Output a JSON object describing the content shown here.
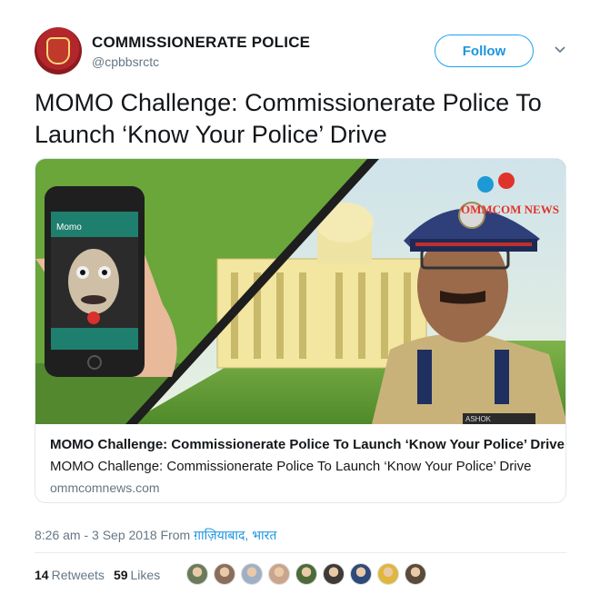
{
  "account": {
    "name": "COMMISSIONERATE POLICE",
    "handle": "@cpbbsrctc",
    "avatar_icon": "police-emblem"
  },
  "follow_label": "Follow",
  "tweet_text": "MOMO Challenge: Commissionerate Police To Launch ‘Know Your Police’ Drive",
  "card": {
    "title": "MOMO Challenge: Commissionerate Police To Launch ‘Know Your Police’ Drive",
    "description": "MOMO Challenge: Commissionerate Police To Launch ‘Know Your Police’ Drive",
    "domain": "ommcomnews.com",
    "image": {
      "watermark": "OMMCOM NEWS",
      "phone_contact_name": "Momo",
      "badge_text": "ASHOK"
    }
  },
  "timestamp": {
    "time": "8:26 am - 3 Sep 2018",
    "from_label": "From",
    "location": "ग़ाज़ियाबाद, भारत"
  },
  "stats": {
    "retweets_count": "14",
    "retweets_label": "Retweets",
    "likes_count": "59",
    "likes_label": "Likes"
  },
  "likers": [
    {
      "color": "#6b7b5a"
    },
    {
      "color": "#8a6d5b"
    },
    {
      "color": "#9fb0c4"
    },
    {
      "color": "#c9a58b"
    },
    {
      "color": "#4d6b3a"
    },
    {
      "color": "#3e3a36"
    },
    {
      "color": "#2f4a7a"
    },
    {
      "color": "#e0b63c"
    },
    {
      "color": "#5a4a3a"
    }
  ],
  "colors": {
    "accent": "#1da1f2",
    "text": "#14171a",
    "muted": "#657786"
  }
}
